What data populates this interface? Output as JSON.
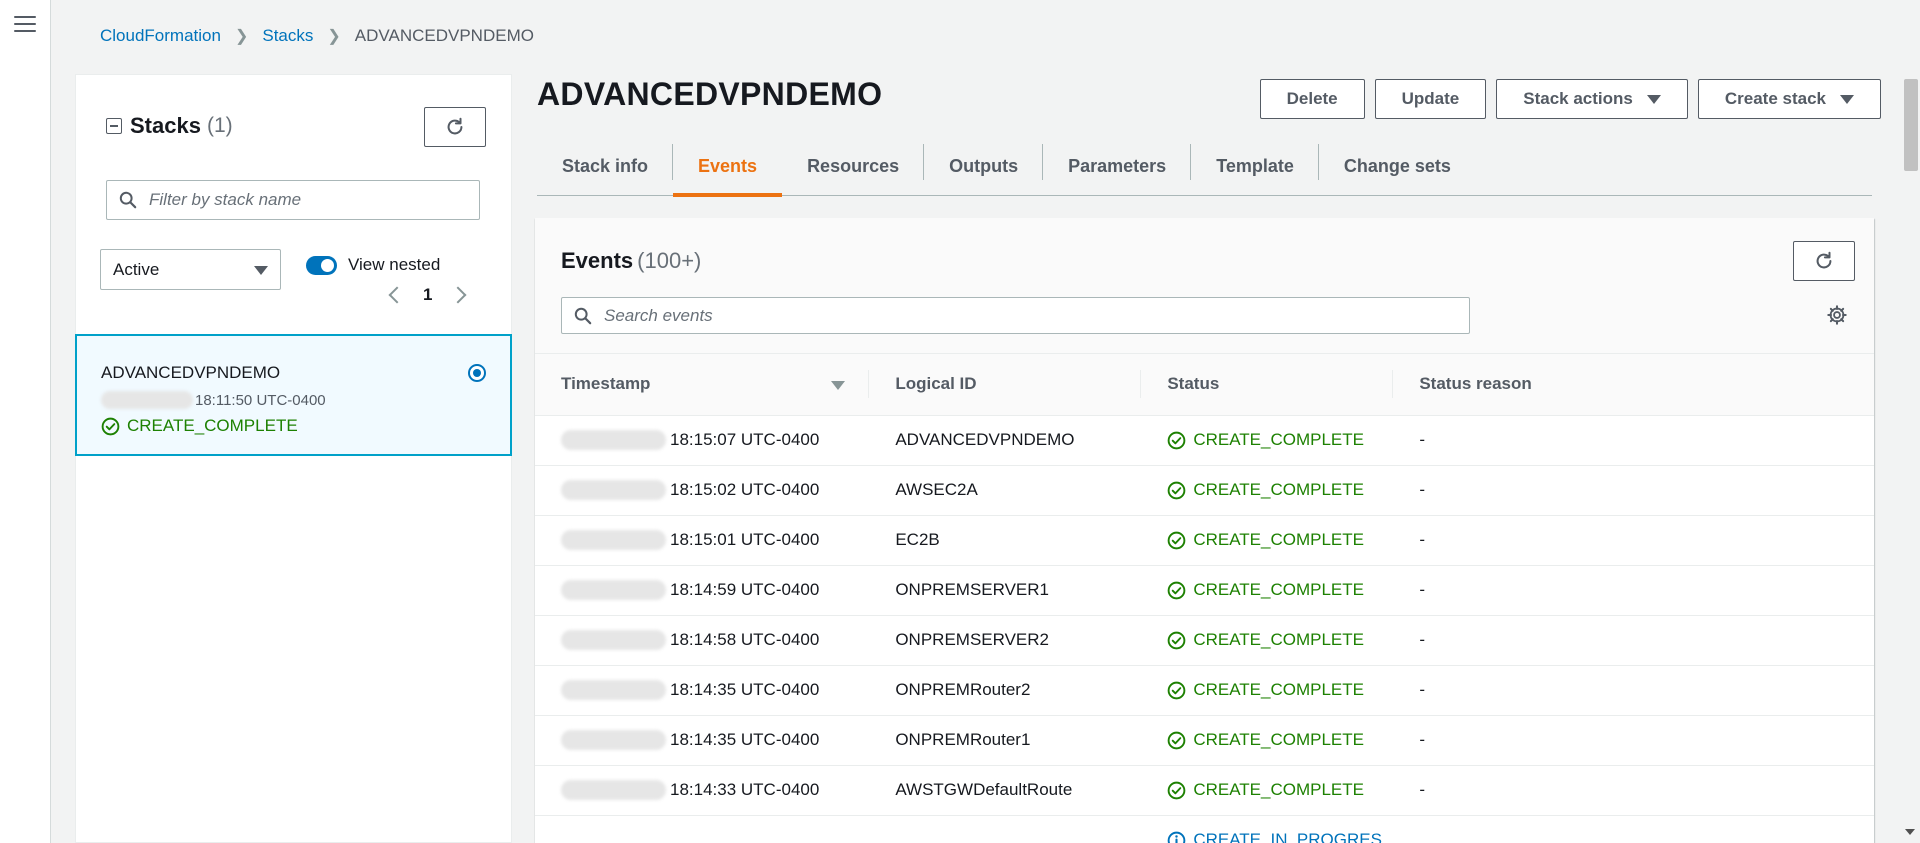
{
  "breadcrumb": {
    "items": [
      "CloudFormation",
      "Stacks"
    ],
    "current": "ADVANCEDVPNDEMO"
  },
  "stacks_panel": {
    "title": "Stacks",
    "count": "(1)",
    "filter_placeholder": "Filter by stack name",
    "status_filter": "Active",
    "view_nested_label": "View nested",
    "page": "1",
    "stack": {
      "name": "ADVANCEDVPNDEMO",
      "time": "18:11:50 UTC-0400",
      "status": "CREATE_COMPLETE"
    }
  },
  "page_title": "ADVANCEDVPNDEMO",
  "actions": {
    "delete": "Delete",
    "update": "Update",
    "stack_actions": "Stack actions",
    "create_stack": "Create stack"
  },
  "tabs": [
    "Stack info",
    "Events",
    "Resources",
    "Outputs",
    "Parameters",
    "Template",
    "Change sets"
  ],
  "events": {
    "title": "Events",
    "count": "(100+)",
    "search_placeholder": "Search events",
    "columns": [
      "Timestamp",
      "Logical ID",
      "Status",
      "Status reason"
    ],
    "rows": [
      {
        "time": "18:15:07 UTC-0400",
        "id": "ADVANCEDVPNDEMO",
        "status": "CREATE_COMPLETE",
        "reason": "-"
      },
      {
        "time": "18:15:02 UTC-0400",
        "id": "AWSEC2A",
        "status": "CREATE_COMPLETE",
        "reason": "-"
      },
      {
        "time": "18:15:01 UTC-0400",
        "id": "EC2B",
        "status": "CREATE_COMPLETE",
        "reason": "-"
      },
      {
        "time": "18:14:59 UTC-0400",
        "id": "ONPREMSERVER1",
        "status": "CREATE_COMPLETE",
        "reason": "-"
      },
      {
        "time": "18:14:58 UTC-0400",
        "id": "ONPREMSERVER2",
        "status": "CREATE_COMPLETE",
        "reason": "-"
      },
      {
        "time": "18:14:35 UTC-0400",
        "id": "ONPREMRouter2",
        "status": "CREATE_COMPLETE",
        "reason": "-"
      },
      {
        "time": "18:14:35 UTC-0400",
        "id": "ONPREMRouter1",
        "status": "CREATE_COMPLETE",
        "reason": "-"
      },
      {
        "time": "18:14:33 UTC-0400",
        "id": "AWSTGWDefaultRoute",
        "status": "CREATE_COMPLETE",
        "reason": "-"
      },
      {
        "time": "",
        "id": "",
        "status": "CREATE_IN_PROGRES",
        "reason": ""
      }
    ]
  },
  "colors": {
    "link": "#0073bb",
    "success": "#1d8102",
    "active_tab": "#ec7211",
    "selected_border": "#00a1c9"
  },
  "icons": [
    "menu-icon",
    "chevron-right-icon",
    "collapse-icon",
    "refresh-icon",
    "search-icon",
    "caret-down-icon",
    "toggle-icon",
    "chevron-left-icon",
    "radio-selected-icon",
    "check-circle-icon",
    "info-circle-icon",
    "gear-icon",
    "sort-desc-icon"
  ]
}
